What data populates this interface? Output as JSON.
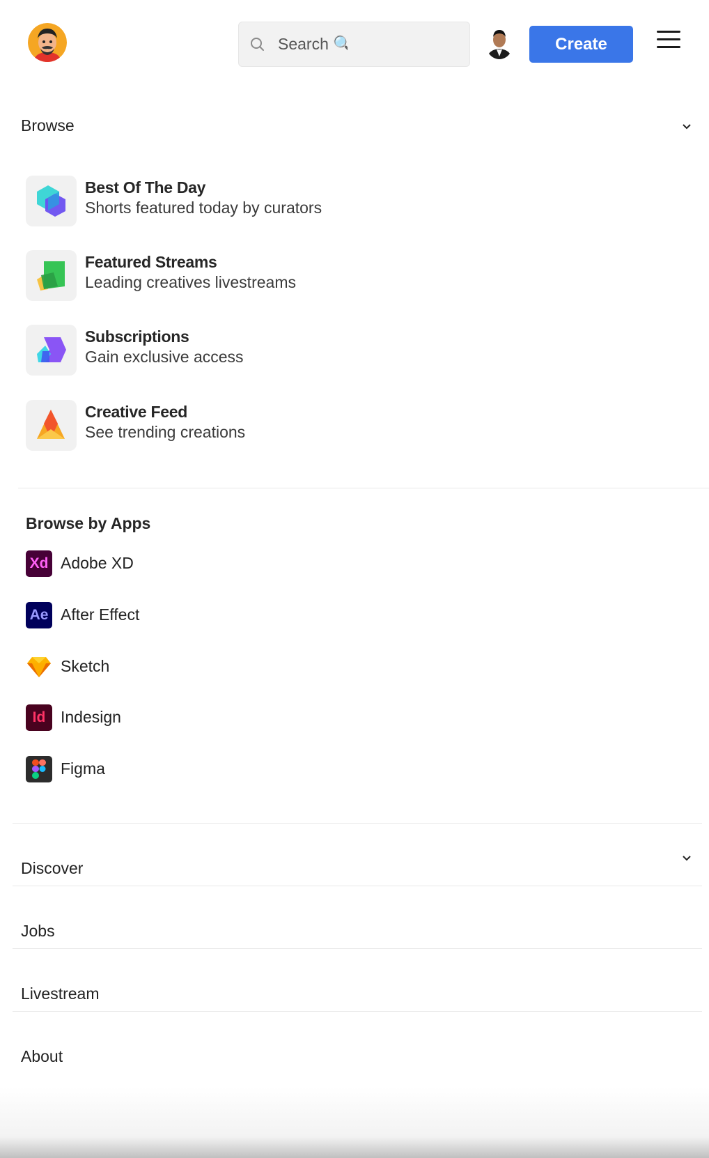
{
  "header": {
    "search_placeholder": "Search 🔍",
    "create_label": "Create"
  },
  "browse": {
    "title": "Browse",
    "items": [
      {
        "title": "Best Of The Day",
        "subtitle": "Shorts featured today by curators"
      },
      {
        "title": "Featured Streams",
        "subtitle": "Leading creatives livestreams"
      },
      {
        "title": "Subscriptions",
        "subtitle": "Gain exclusive access"
      },
      {
        "title": "Creative Feed",
        "subtitle": "See trending creations"
      }
    ]
  },
  "apps": {
    "title": "Browse by Apps",
    "items": [
      {
        "label": "Adobe XD",
        "abbr": "Xd",
        "bg": "#470137",
        "fg": "#ff61f6"
      },
      {
        "label": "After Effect",
        "abbr": "Ae",
        "bg": "#00005b",
        "fg": "#9999ff"
      },
      {
        "label": "Sketch",
        "abbr": "",
        "bg": "#ffffff",
        "fg": "#f7b500"
      },
      {
        "label": "Indesign",
        "abbr": "Id",
        "bg": "#49021f",
        "fg": "#ff3366"
      },
      {
        "label": "Figma",
        "abbr": "",
        "bg": "#2c2c2c",
        "fg": "#ffffff"
      }
    ]
  },
  "nav": {
    "discover": "Discover",
    "jobs": "Jobs",
    "livestream": "Livestream",
    "about": "About"
  },
  "colors": {
    "accent": "#3a76e8"
  }
}
